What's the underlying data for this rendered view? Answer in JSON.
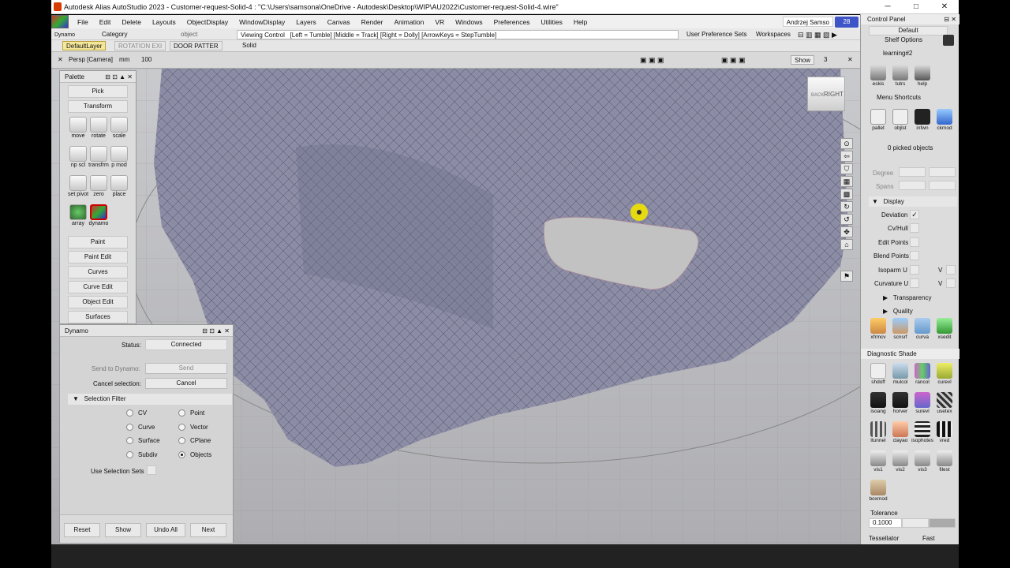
{
  "window": {
    "title": "Autodesk Alias AutoStudio 2023    -  Customer-request-Solid-4 : \"C:\\Users\\samsona\\OneDrive - Autodesk\\Desktop\\WIP\\AU2022\\Customer-request-Solid-4.wire\"",
    "min": "─",
    "max": "□",
    "close": "✕"
  },
  "menu": [
    "File",
    "Edit",
    "Delete",
    "Layouts",
    "ObjectDisplay",
    "WindowDisplay",
    "Layers",
    "Canvas",
    "Render",
    "Animation",
    "VR",
    "Windows",
    "Preferences",
    "Utilities",
    "Help"
  ],
  "user": {
    "name": "Andrzej Samso",
    "badge": "28"
  },
  "row2": {
    "dynamo": "Dynamo",
    "category": "Category",
    "object": "object",
    "viewing": "Viewing Control",
    "hint": "[Left = Tumble]   [Middle = Track]   [Right = Dolly]   [ArrowKeys = StepTumble]",
    "prefs": "User Preference Sets",
    "workspaces": "Workspaces"
  },
  "row3": {
    "layer": "DefaultLayer",
    "rot": "ROTATION EXI",
    "door": "DOOR PATTER",
    "solid": "Solid"
  },
  "viewport": {
    "camera": "Persp [Camera]",
    "units": "mm",
    "zoom": "100",
    "show": "Show",
    "count": "3",
    "cube_right": "RIGHT",
    "cube_back": "BACK"
  },
  "palette": {
    "title": "Palette",
    "pick": "Pick",
    "transform": "Transform",
    "tools": [
      "move",
      "rotate",
      "scale",
      "np scl",
      "transfrm",
      "p mod",
      "set pivot",
      "zero",
      "place",
      "array",
      "dynamo"
    ],
    "sections": [
      "Paint",
      "Paint Edit",
      "Curves",
      "Curve Edit",
      "Object Edit",
      "Surfaces"
    ]
  },
  "dynamo": {
    "title": "Dynamo",
    "status_label": "Status:",
    "status_value": "Connected",
    "send_label": "Send to Dynamo:",
    "send_btn": "Send",
    "cancel_label": "Cancel selection:",
    "cancel_btn": "Cancel",
    "filter_title": "Selection Filter",
    "filters": [
      "CV",
      "Point",
      "Curve",
      "Vector",
      "Surface",
      "CPlane",
      "Subdiv",
      "Objects"
    ],
    "selected": "Objects",
    "use_sets": "Use Selection Sets",
    "buttons": [
      "Reset",
      "Show",
      "Undo All",
      "Next"
    ]
  },
  "cpanel": {
    "title": "Control Panel",
    "default": "Default",
    "shelf": "Shelf Options",
    "learning": "learning#2",
    "icons1": [
      "eskis",
      "tutrs",
      "help"
    ],
    "menu_shortcuts": "Menu Shortcuts",
    "icons2": [
      "pallet",
      "objlst",
      "infwn",
      "ckmod"
    ],
    "picked": "0 picked objects",
    "degree": "Degree",
    "spans": "Spans",
    "display": "Display",
    "deviation": "Deviation",
    "cvhull": "Cv/Hull",
    "editpoints": "Edit Points",
    "blendpoints": "Blend Points",
    "isoparm": "Isoparm U",
    "curvature": "Curvature U",
    "v": "V",
    "transparency": "Transparency",
    "quality": "Quality",
    "icons3": [
      "xfrmcv",
      "scnsrf",
      "curva",
      "xsedit"
    ],
    "diag": "Diagnostic Shade",
    "diag_icons": [
      "shdoff",
      "mulcol",
      "rancol",
      "curevl",
      "isoang",
      "horver",
      "surevl",
      "usetex",
      "ltunnel",
      "clayao",
      "isophotes",
      "vred",
      "vis1",
      "vis2",
      "vis3",
      "filest",
      "boxmod"
    ],
    "tolerance": "Tolerance",
    "tol_value": "0.1000",
    "tessellator": "Tessellator",
    "tess_value": "Fast"
  },
  "colors": {
    "mesh": "#8d8ea6",
    "highlight": "#f1e300",
    "accent_layer": "#f5e79a"
  }
}
